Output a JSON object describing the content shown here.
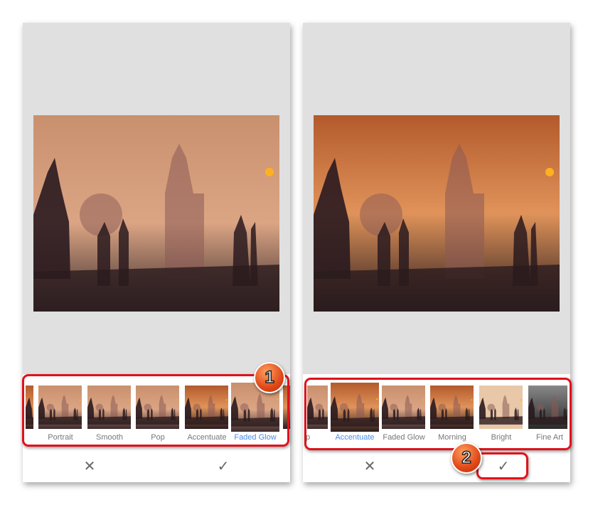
{
  "left_panel": {
    "filters": [
      {
        "label": "",
        "selected": false
      },
      {
        "label": "Portrait",
        "selected": false
      },
      {
        "label": "Smooth",
        "selected": false
      },
      {
        "label": "Pop",
        "selected": false
      },
      {
        "label": "Accentuate",
        "selected": false
      },
      {
        "label": "Faded Glow",
        "selected": true
      }
    ],
    "cancel_icon": "close-icon",
    "apply_icon": "check-icon",
    "step_badge": "1"
  },
  "right_panel": {
    "filters": [
      {
        "label": "p",
        "selected": false
      },
      {
        "label": "Accentuate",
        "selected": true
      },
      {
        "label": "Faded Glow",
        "selected": false
      },
      {
        "label": "Morning",
        "selected": false
      },
      {
        "label": "Bright",
        "selected": false
      },
      {
        "label": "Fine Art",
        "selected": false
      }
    ],
    "cancel_icon": "close-icon",
    "apply_icon": "check-icon",
    "step_badge": "2"
  },
  "colors": {
    "selected_label": "#4a8cf0",
    "highlight_frame": "#e0121b",
    "canvas_bg": "#e0e0e0"
  }
}
